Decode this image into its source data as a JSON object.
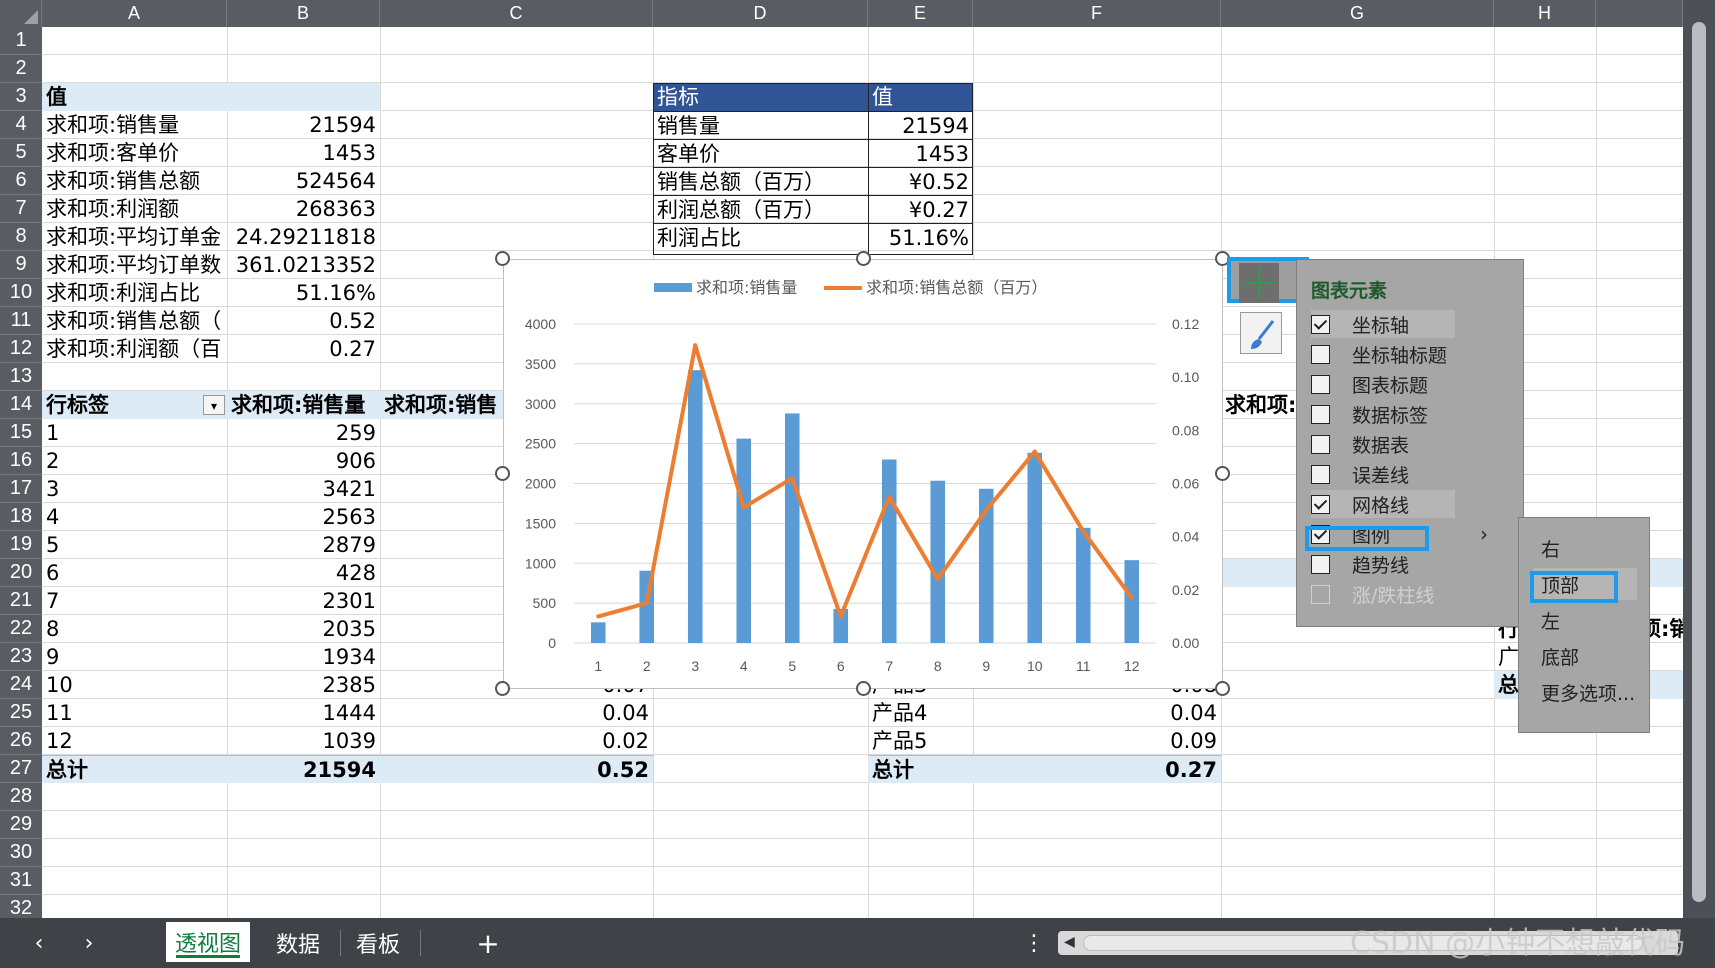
{
  "columns": [
    "A",
    "B",
    "C",
    "D",
    "E",
    "F",
    "G",
    "H"
  ],
  "rows": [
    "1",
    "2",
    "3",
    "4",
    "5",
    "6",
    "7",
    "8",
    "9",
    "10",
    "11",
    "12",
    "13",
    "14",
    "15",
    "16",
    "17",
    "18",
    "19",
    "20",
    "21",
    "22",
    "23",
    "24",
    "25",
    "26",
    "27",
    "28",
    "29",
    "30",
    "31",
    "32"
  ],
  "summary": {
    "header": "值",
    "items": [
      {
        "label": "求和项:销售量",
        "value": "21594"
      },
      {
        "label": "求和项:客单价",
        "value": "1453"
      },
      {
        "label": "求和项:销售总额",
        "value": "524564"
      },
      {
        "label": "求和项:利润额",
        "value": "268363"
      },
      {
        "label": "求和项:平均订单金",
        "value": "24.29211818"
      },
      {
        "label": "求和项:平均订单数",
        "value": "361.0213352"
      },
      {
        "label": "求和项:利润占比",
        "value": "51.16%"
      },
      {
        "label": "求和项:销售总额（",
        "value": "0.52"
      },
      {
        "label": "求和项:利润额（百",
        "value": "0.27"
      }
    ]
  },
  "kpi": {
    "headers": [
      "指标",
      "值"
    ],
    "rows": [
      {
        "label": "销售量",
        "value": "21594"
      },
      {
        "label": "客单价",
        "value": "1453"
      },
      {
        "label": "销售总额（百万）",
        "value": "¥0.52"
      },
      {
        "label": "利润总额（百万）",
        "value": "¥0.27"
      },
      {
        "label": "利润占比",
        "value": "51.16%"
      }
    ]
  },
  "pivot": {
    "headers": [
      "行标签",
      "求和项:销售量",
      "求和项:销售"
    ],
    "rows": [
      {
        "label": "1",
        "qty": "259",
        "amt": ""
      },
      {
        "label": "2",
        "qty": "906",
        "amt": ""
      },
      {
        "label": "3",
        "qty": "3421",
        "amt": ""
      },
      {
        "label": "4",
        "qty": "2563",
        "amt": ""
      },
      {
        "label": "5",
        "qty": "2879",
        "amt": ""
      },
      {
        "label": "6",
        "qty": "428",
        "amt": ""
      },
      {
        "label": "7",
        "qty": "2301",
        "amt": ""
      },
      {
        "label": "8",
        "qty": "2035",
        "amt": ""
      },
      {
        "label": "9",
        "qty": "1934",
        "amt": ""
      },
      {
        "label": "10",
        "qty": "2385",
        "amt": "0.07"
      },
      {
        "label": "11",
        "qty": "1444",
        "amt": "0.04"
      },
      {
        "label": "12",
        "qty": "1039",
        "amt": "0.02"
      }
    ],
    "total": {
      "label": "总计",
      "qty": "21594",
      "amt": "0.52"
    }
  },
  "products": {
    "header_partial": "求和项:",
    "rows": [
      {
        "label": "产品3",
        "value": "0.08"
      },
      {
        "label": "产品4",
        "value": "0.04"
      },
      {
        "label": "产品5",
        "value": "0.09"
      }
    ],
    "total": {
      "label": "总计",
      "value": "0.27"
    }
  },
  "partial_right": {
    "row_label": "行",
    "col_label": "项:销",
    "item": "广",
    "total": "总"
  },
  "chart_data": {
    "type": "bar",
    "categories": [
      "1",
      "2",
      "3",
      "4",
      "5",
      "6",
      "7",
      "8",
      "9",
      "10",
      "11",
      "12"
    ],
    "series": [
      {
        "name": "求和项:销售量",
        "type": "bar",
        "axis": "left",
        "color": "#5b9bd5",
        "values": [
          259,
          906,
          3421,
          2563,
          2879,
          428,
          2301,
          2035,
          1934,
          2385,
          1444,
          1039
        ]
      },
      {
        "name": "求和项:销售总额（百万）",
        "type": "line",
        "axis": "right",
        "color": "#ed7d31",
        "values": [
          0.01,
          0.015,
          0.112,
          0.051,
          0.062,
          0.01,
          0.055,
          0.024,
          0.05,
          0.072,
          0.042,
          0.017
        ]
      }
    ],
    "ylim": [
      0,
      4000
    ],
    "yticks": [
      "0",
      "500",
      "1000",
      "1500",
      "2000",
      "2500",
      "3000",
      "3500",
      "4000"
    ],
    "y2lim": [
      0,
      0.12
    ],
    "y2ticks": [
      "0.00",
      "0.02",
      "0.04",
      "0.06",
      "0.08",
      "0.10",
      "0.12"
    ],
    "legend": "top",
    "grid": true
  },
  "chart_elements": {
    "title": "图表元素",
    "items": [
      {
        "label": "坐标轴",
        "checked": true
      },
      {
        "label": "坐标轴标题",
        "checked": false
      },
      {
        "label": "图表标题",
        "checked": false
      },
      {
        "label": "数据标签",
        "checked": false
      },
      {
        "label": "数据表",
        "checked": false
      },
      {
        "label": "误差线",
        "checked": false
      },
      {
        "label": "网格线",
        "checked": true
      },
      {
        "label": "图例",
        "checked": true
      },
      {
        "label": "趋势线",
        "checked": false
      },
      {
        "label": "涨/跌柱线",
        "checked": false
      }
    ],
    "arrow": "›"
  },
  "legend_menu": [
    "右",
    "顶部",
    "左",
    "底部",
    "更多选项..."
  ],
  "tabs": {
    "prev": "‹",
    "next": "›",
    "sheets": [
      "透视图",
      "数据",
      "看板"
    ],
    "add": "+",
    "more": "⋮"
  },
  "watermark": "CSDN @小钟不想敲代码",
  "colors": {
    "header_bg": "#595d63",
    "pivot_fill": "#ddebf7",
    "kpi_header": "#2f5597",
    "accent_blue": "#1e9be8",
    "active_tab": "#107c41"
  }
}
